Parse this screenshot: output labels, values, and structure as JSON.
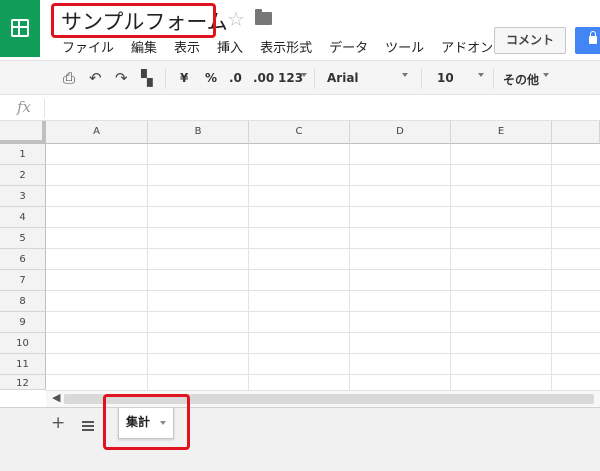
{
  "header": {
    "title": "サンプルフォーム",
    "menus": [
      "ファイル",
      "編集",
      "表示",
      "挿入",
      "表示形式",
      "データ",
      "ツール",
      "アドオン"
    ],
    "comment_button": "コメント"
  },
  "toolbar": {
    "currency": "¥",
    "percent": "%",
    "decrease_decimal": ".0",
    "increase_decimal": ".00",
    "number_format": "123",
    "font": "Arial",
    "font_size": "10",
    "more": "その他"
  },
  "sheet": {
    "columns": [
      "A",
      "B",
      "C",
      "D",
      "E"
    ],
    "rows": [
      "1",
      "2",
      "3",
      "4",
      "5",
      "6",
      "7",
      "8",
      "9",
      "10",
      "11",
      "12"
    ],
    "tab_label": "集計"
  },
  "colors": {
    "brand": "#0f9d58",
    "share": "#4285f4",
    "highlight": "#e0141e"
  },
  "icons": [
    "sheets-logo-icon",
    "star-icon",
    "folder-icon",
    "lock-icon",
    "print-icon",
    "undo-icon",
    "redo-icon",
    "paint-format-icon",
    "fx-icon",
    "scroll-left-icon",
    "add-sheet-icon",
    "sheet-list-icon"
  ]
}
